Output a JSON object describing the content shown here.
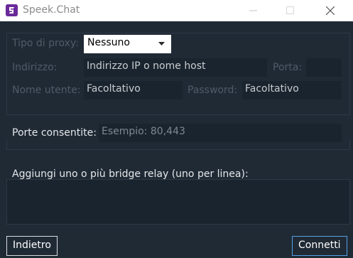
{
  "window": {
    "title": "Speek.Chat",
    "icon": "speek-logo-icon",
    "controls": [
      "minimize-icon",
      "maximize-icon",
      "close-icon"
    ]
  },
  "proxy": {
    "type_label": "Tipo di proxy:",
    "type_value": "Nessuno",
    "address_label": "Indirizzo:",
    "address_placeholder": "Indirizzo IP o nome host",
    "port_label": "Porta:",
    "port_value": "",
    "username_label": "Nome utente:",
    "username_placeholder": "Facoltativo",
    "password_label": "Password:",
    "password_placeholder": "Facoltativo"
  },
  "ports": {
    "label": "Porte consentite:",
    "placeholder": "Esempio: 80,443"
  },
  "bridges": {
    "label": "Aggiungi uno o più bridge relay (uno per linea):",
    "value": ""
  },
  "buttons": {
    "back": "Indietro",
    "connect": "Connetti"
  },
  "colors": {
    "background": "#1f2a35",
    "field_background": "#1a242e",
    "disabled_text": "#4f5b66",
    "primary_border": "#5aa0e6"
  }
}
